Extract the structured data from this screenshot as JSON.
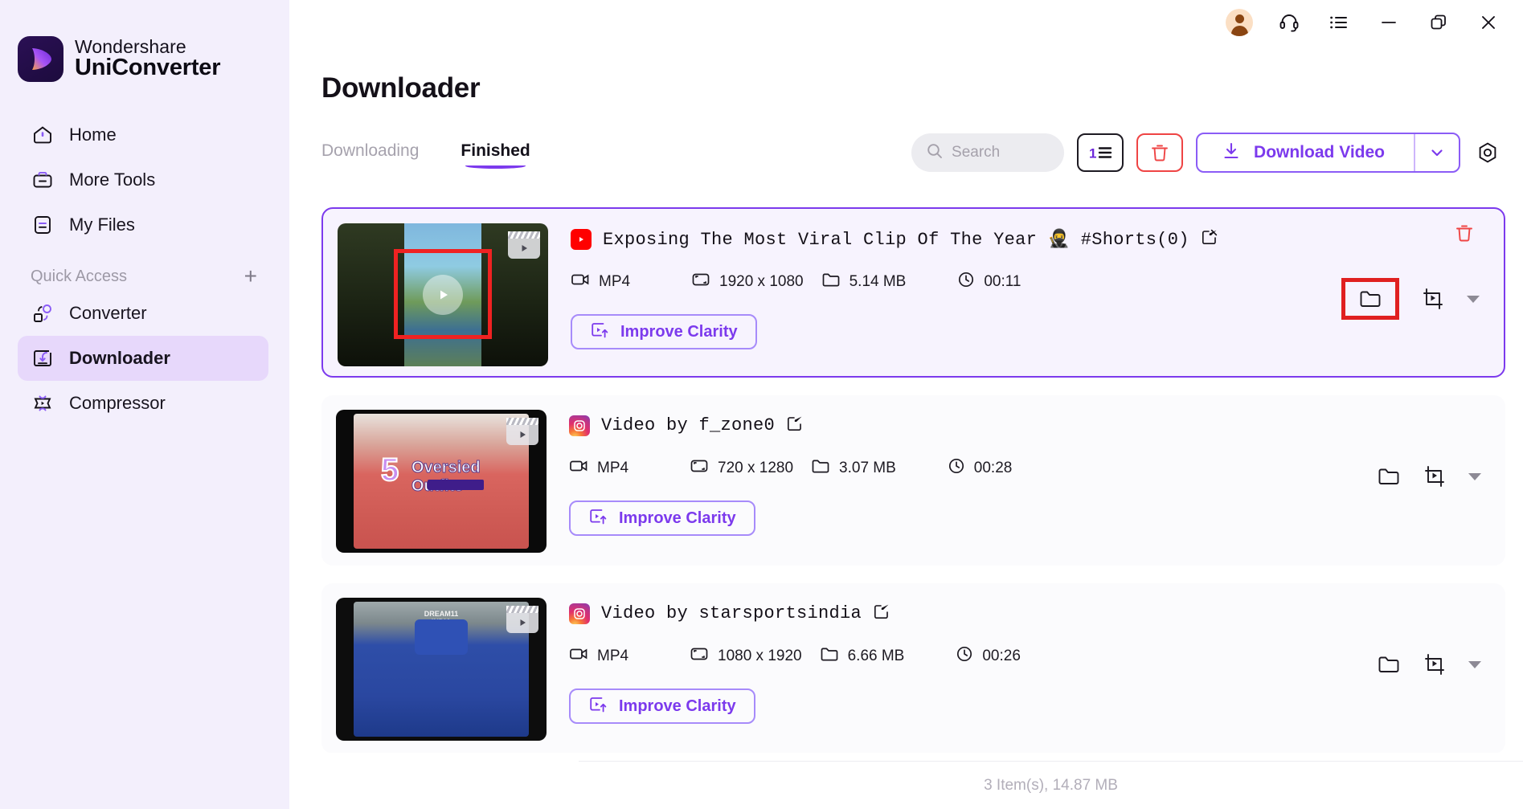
{
  "sidebar": {
    "brand": {
      "line1": "Wondershare",
      "line2": "UniConverter",
      "logo_icon": "uniconverter-logo-icon"
    },
    "items": [
      {
        "label": "Home",
        "icon": "home-icon",
        "active": false
      },
      {
        "label": "More Tools",
        "icon": "toolbox-icon",
        "active": false
      },
      {
        "label": "My Files",
        "icon": "my-files-icon",
        "active": false
      }
    ],
    "quick_access": {
      "label": "Quick Access",
      "add_icon": "plus-icon"
    },
    "quick_items": [
      {
        "label": "Converter",
        "icon": "converter-icon",
        "active": false
      },
      {
        "label": "Downloader",
        "icon": "downloader-icon",
        "active": true
      },
      {
        "label": "Compressor",
        "icon": "compressor-icon",
        "active": false
      }
    ]
  },
  "titlebar": {
    "buttons": [
      {
        "name": "account-avatar",
        "icon": "user-avatar-icon"
      },
      {
        "name": "support-button",
        "icon": "headset-icon"
      },
      {
        "name": "menu-button",
        "icon": "list-menu-icon"
      },
      {
        "name": "minimize-button",
        "icon": "minimize-icon"
      },
      {
        "name": "maximize-button",
        "icon": "restore-icon"
      },
      {
        "name": "close-button",
        "icon": "close-icon"
      }
    ]
  },
  "page": {
    "title": "Downloader"
  },
  "tabs": [
    {
      "label": "Downloading",
      "active": false
    },
    {
      "label": "Finished",
      "active": true
    }
  ],
  "toolbar": {
    "search": {
      "placeholder": "Search",
      "value": "",
      "icon": "search-icon"
    },
    "sort_button": {
      "icon": "sort-numeric-icon",
      "label": "1"
    },
    "delete_button": {
      "icon": "trash-icon"
    },
    "download_button": {
      "label": "Download Video",
      "icon": "download-icon",
      "caret_icon": "chevron-down-icon"
    },
    "settings_button": {
      "icon": "gear-icon"
    }
  },
  "colors": {
    "accent": "#7c3aed",
    "accent_light": "#a78bfa",
    "danger": "#ef4444",
    "highlight_box": "#e02020",
    "sidebar_bg": "#f3effc",
    "selected_card_bg": "#f7f3fe"
  },
  "items": [
    {
      "title": "Exposing The Most Viral Clip Of The Year 🥷 #Shorts(0)",
      "source": "youtube",
      "source_icon": "youtube-icon",
      "edit_icon": "edit-icon",
      "format": "MP4",
      "resolution": "1920 x 1080",
      "size": "5.14 MB",
      "duration": "00:11",
      "improve_label": "Improve Clarity",
      "improve_icon": "improve-clarity-icon",
      "selected": true,
      "highlighted_action": "open-folder",
      "actions": {
        "delete_icon": "trash-icon",
        "folder_icon": "folder-icon",
        "convert_icon": "crop-video-icon",
        "more_icon": "caret-down-icon"
      }
    },
    {
      "title": "Video by f_zone0",
      "source": "instagram",
      "source_icon": "instagram-icon",
      "edit_icon": "edit-icon",
      "format": "MP4",
      "resolution": "720 x 1280",
      "size": "3.07 MB",
      "duration": "00:28",
      "improve_label": "Improve Clarity",
      "improve_icon": "improve-clarity-icon",
      "selected": false,
      "actions": {
        "folder_icon": "folder-icon",
        "convert_icon": "crop-video-icon",
        "more_icon": "caret-down-icon"
      }
    },
    {
      "title": "Video by starsportsindia",
      "source": "instagram",
      "source_icon": "instagram-icon",
      "edit_icon": "edit-icon",
      "format": "MP4",
      "resolution": "1080 x 1920",
      "size": "6.66 MB",
      "duration": "00:26",
      "improve_label": "Improve Clarity",
      "improve_icon": "improve-clarity-icon",
      "selected": false,
      "actions": {
        "folder_icon": "folder-icon",
        "convert_icon": "crop-video-icon",
        "more_icon": "caret-down-icon"
      }
    }
  ],
  "footer": {
    "status": "3 Item(s), 14.87 MB"
  }
}
